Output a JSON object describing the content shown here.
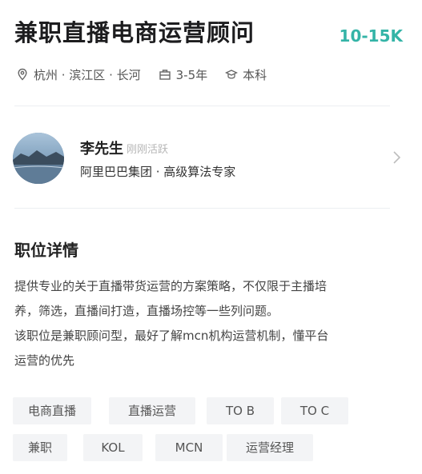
{
  "job": {
    "title": "兼职直播电商运营顾问",
    "salary": "10-15K",
    "location": "杭州 · 滨江区 · 长河",
    "experience": "3-5年",
    "education": "本科"
  },
  "recruiter": {
    "name": "李先生",
    "status": "刚刚活跃",
    "company_title": "阿里巴巴集团 · 高级算法专家"
  },
  "details": {
    "heading": "职位详情",
    "lines": [
      "提供专业的关于直播带货运营的方案策略，不仅限于主播培",
      "养，筛选，直播间打造，直播场控等一些列问题。",
      "该职位是兼职顾问型，最好了解mcn机构运营机制，懂平台",
      "运营的优先"
    ]
  },
  "tags": [
    "电商直播",
    "直播运营",
    "TO B",
    "TO C",
    "兼职",
    "KOL",
    "MCN",
    "运营经理"
  ],
  "icons": {
    "location": "location-pin-icon",
    "experience": "briefcase-icon",
    "education": "graduation-cap-icon",
    "chevron": "chevron-right-icon"
  },
  "colors": {
    "salary": "#34b4a7",
    "tag_bg": "#f3f4f6"
  }
}
